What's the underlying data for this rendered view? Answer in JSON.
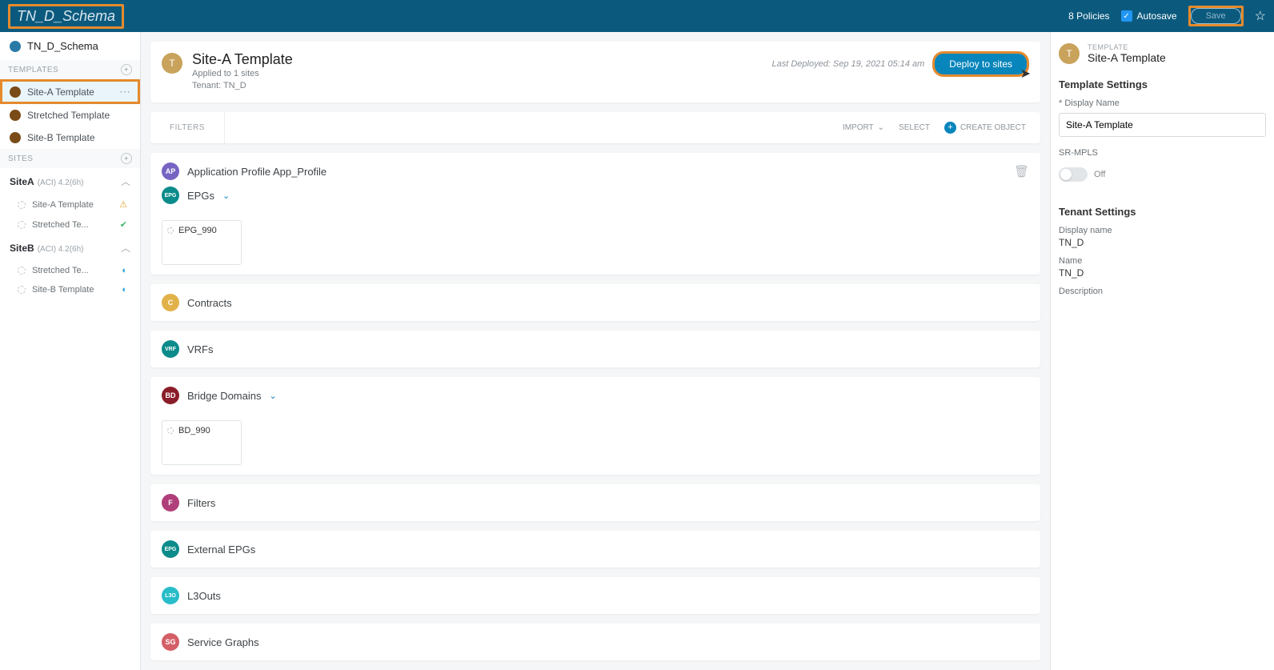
{
  "topbar": {
    "title": "TN_D_Schema",
    "policies": "8 Policies",
    "autosave": "Autosave",
    "save": "Save"
  },
  "sidebar": {
    "schema": "TN_D_Schema",
    "templates_label": "TEMPLATES",
    "templates": [
      {
        "label": "Site-A Template",
        "selected": true
      },
      {
        "label": "Stretched Template"
      },
      {
        "label": "Site-B Template"
      }
    ],
    "sites_label": "SITES",
    "sites": [
      {
        "name": "SiteA",
        "meta": "(ACI)  4.2(6h)",
        "items": [
          {
            "label": "Site-A Template",
            "status": "warn"
          },
          {
            "label": "Stretched Te...",
            "status": "ok"
          }
        ]
      },
      {
        "name": "SiteB",
        "meta": "(ACI)  4.2(6h)",
        "items": [
          {
            "label": "Stretched Te...",
            "status": "load"
          },
          {
            "label": "Site-B Template",
            "status": "load"
          }
        ]
      }
    ]
  },
  "template_header": {
    "avatar": "T",
    "title": "Site-A Template",
    "applied": "Applied to 1 sites",
    "tenant": "Tenant: TN_D",
    "last_deployed": "Last Deployed: Sep 19, 2021 05:14 am",
    "deploy": "Deploy to sites"
  },
  "filters": {
    "label": "FILTERS",
    "import": "IMPORT",
    "select": "SELECT",
    "create": "CREATE OBJECT"
  },
  "sections": {
    "app_profile": {
      "badge": "AP",
      "color": "#7764c2",
      "label": "Application Profile App_Profile"
    },
    "epgs": {
      "badge": "EPG",
      "color": "#0c8b8b",
      "label": "EPGs",
      "items": [
        "EPG_990"
      ]
    },
    "contracts": {
      "badge": "C",
      "color": "#e2b24a",
      "label": "Contracts"
    },
    "vrfs": {
      "badge": "VRF",
      "color": "#0c8b8b",
      "label": "VRFs"
    },
    "bds": {
      "badge": "BD",
      "color": "#8a1d29",
      "label": "Bridge Domains",
      "items": [
        "BD_990"
      ]
    },
    "filters": {
      "badge": "F",
      "color": "#b03e7a",
      "label": "Filters"
    },
    "ext_epgs": {
      "badge": "EPG",
      "color": "#0c8b8b",
      "label": "External EPGs"
    },
    "l3outs": {
      "badge": "L3O",
      "color": "#29bcc9",
      "label": "L3Outs"
    },
    "sgraphs": {
      "badge": "SG",
      "color": "#d45f67",
      "label": "Service Graphs"
    }
  },
  "rightpanel": {
    "avatar": "T",
    "label_sm": "TEMPLATE",
    "label_lg": "Site-A Template",
    "tpl_settings": "Template Settings",
    "display_name_label": "* Display Name",
    "display_name": "Site-A Template",
    "srmpls": "SR-MPLS",
    "srmpls_val": "Off",
    "tenant_settings": "Tenant Settings",
    "disp_name_k": "Display name",
    "disp_name_v": "TN_D",
    "name_k": "Name",
    "name_v": "TN_D",
    "desc_k": "Description"
  }
}
